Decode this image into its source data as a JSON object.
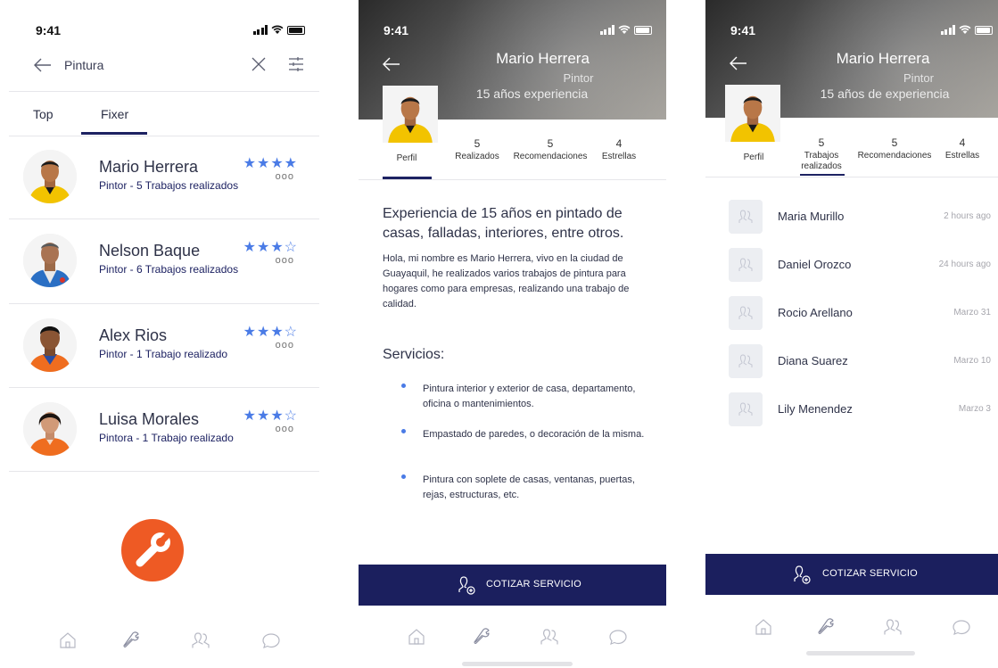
{
  "status": {
    "time": "9:41"
  },
  "search_screen": {
    "query": "Pintura",
    "tabs": [
      "Top",
      "Fixer"
    ],
    "workers": [
      {
        "name": "Mario Herrera",
        "subtitle": "Pintor - 5 Trabajos realizados",
        "stars": "★★★★",
        "rating": 4,
        "more": "ooo"
      },
      {
        "name": "Nelson Baque",
        "subtitle": "Pintor - 6 Trabajos realizados",
        "stars": "★★★☆",
        "rating": 3,
        "more": "ooo"
      },
      {
        "name": "Alex Rios",
        "subtitle": "Pintor - 1 Trabajo realizado",
        "stars": "★★★☆",
        "rating": 3,
        "more": "ooo"
      },
      {
        "name": "Luisa Morales",
        "subtitle": "Pintora - 1 Trabajo realizado",
        "stars": "★★★☆",
        "rating": 3,
        "more": "ooo"
      }
    ]
  },
  "profile_screen": {
    "name": "Mario Herrera",
    "role": "Pintor",
    "experience": "15 años experiencia",
    "stats": [
      {
        "num": "",
        "label": "Perfil"
      },
      {
        "num": "5",
        "label": "Realizados"
      },
      {
        "num": "5",
        "label": "Recomendaciones"
      },
      {
        "num": "4",
        "label": "Estrellas"
      }
    ],
    "about_title": "Experiencia de 15 años en pintado de casas, falladas, interiores, entre otros.",
    "about_body": "Hola, mi nombre es Mario Herrera, vivo en la ciudad de Guayaquil, he realizados varios trabajos de pintura para hogares como para empresas, realizando una trabajo de calidad.",
    "services_title": "Servicios:",
    "services": [
      "Pintura interior y exterior de casa, departamento, oficina  o mantenimientos.",
      "Empastado de paredes, o decoración de la misma.",
      "Pintura con soplete de casas, ventanas, puertas, rejas, estructuras, etc."
    ],
    "cta": "COTIZAR SERVICIO"
  },
  "reviews_screen": {
    "name": "Mario Herrera",
    "role": "Pintor",
    "experience": "15 años de experiencia",
    "stats": [
      {
        "num": "",
        "label": "Perfil"
      },
      {
        "num": "5",
        "label": "Trabajos realizados"
      },
      {
        "num": "5",
        "label": "Recomendaciones"
      },
      {
        "num": "4",
        "label": "Estrellas"
      }
    ],
    "reviews": [
      {
        "name": "Maria Murillo",
        "time": "2 hours ago"
      },
      {
        "name": "Daniel Orozco",
        "time": "24 hours ago"
      },
      {
        "name": "Rocio Arellano",
        "time": "Marzo 31"
      },
      {
        "name": "Diana Suarez",
        "time": "Marzo  10"
      },
      {
        "name": "Lily Menendez",
        "time": "Marzo 3"
      }
    ],
    "cta": "COTIZAR SERVICIO"
  },
  "tabbar_icons": [
    "home-icon",
    "wrench-icon",
    "people-icon",
    "chat-icon"
  ],
  "colors": {
    "navy": "#1b1f5e",
    "star_blue": "#4a7be6",
    "orange": "#ee5a24",
    "shirt_yellow": "#f2c300"
  }
}
